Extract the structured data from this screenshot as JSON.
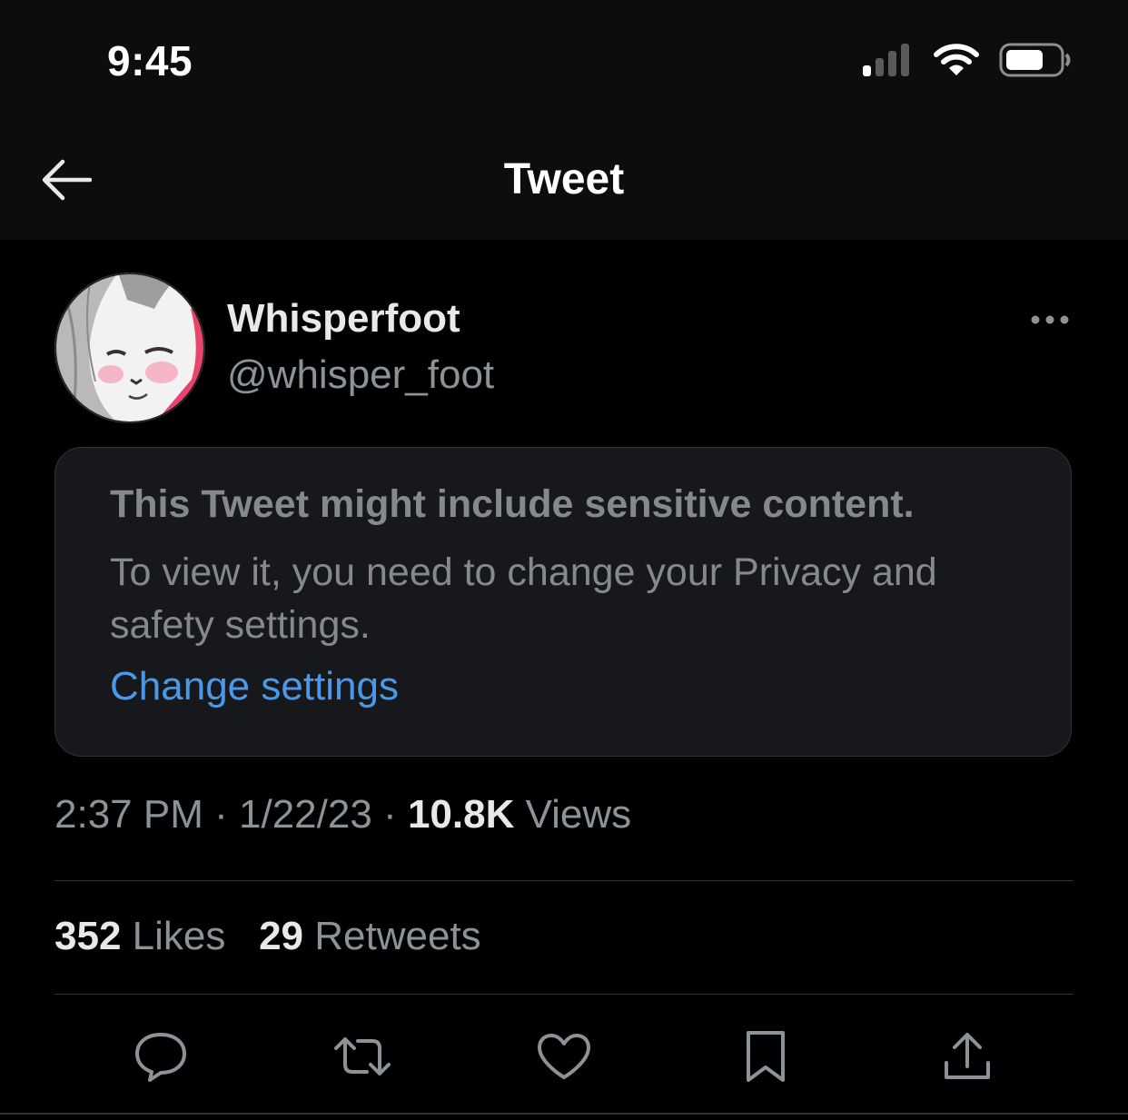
{
  "status_bar": {
    "time": "9:45"
  },
  "nav": {
    "title": "Tweet",
    "back_icon": "arrow-left-icon"
  },
  "tweet": {
    "author_name": "Whisperfoot",
    "author_handle": "@whisper_foot",
    "more_icon": "more-horizontal-icon",
    "notice": {
      "title": "This Tweet might include sensitive content.",
      "body": "To view it, you need to change your Privacy and safety settings.",
      "link": "Change settings"
    },
    "meta": {
      "time": "2:37 PM",
      "separator": "·",
      "date": "1/22/23",
      "views_count": "10.8K",
      "views_label": "Views"
    },
    "stats": {
      "likes_count": "352",
      "likes_label": "Likes",
      "retweets_count": "29",
      "retweets_label": "Retweets"
    },
    "actions": [
      {
        "name": "reply",
        "icon": "reply-bubble-icon"
      },
      {
        "name": "retweet",
        "icon": "retweet-icon"
      },
      {
        "name": "like",
        "icon": "heart-icon"
      },
      {
        "name": "bookmark",
        "icon": "bookmark-icon"
      },
      {
        "name": "share",
        "icon": "share-upload-icon"
      }
    ]
  },
  "colors": {
    "background": "#000000",
    "bar_background": "#0d0d0d",
    "card_background": "#16181c",
    "primary_text": "#e7e9ea",
    "secondary_text": "#8b9298",
    "link": "#4a99e9",
    "divider": "#2f3336"
  }
}
